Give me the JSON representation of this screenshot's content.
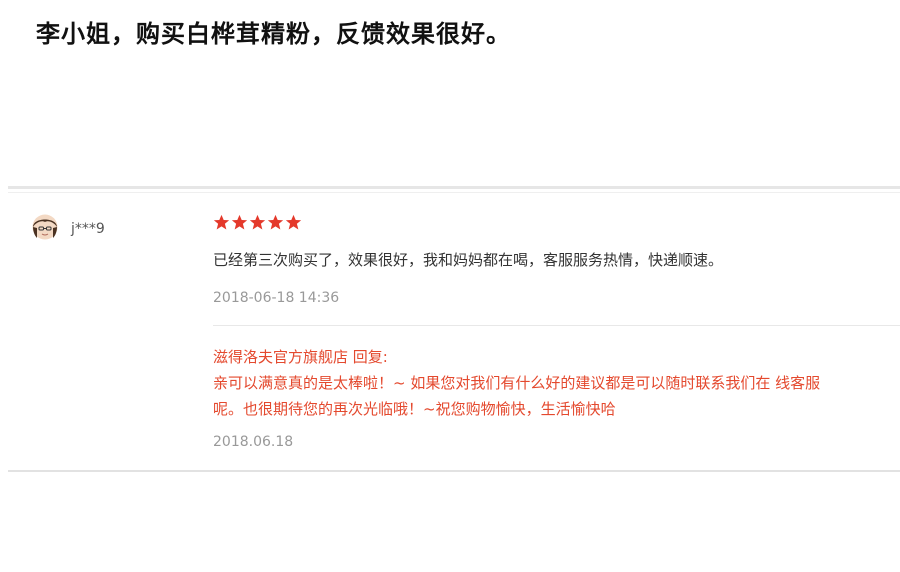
{
  "headline": "李小姐，购买白桦茸精粉，反馈效果很好。",
  "review": {
    "user": "j***9",
    "avatar_icon": "user-avatar-icon",
    "rating": 5,
    "rating_max": 5,
    "star_color": "#e4392b",
    "comment": "已经第三次购买了，效果很好，我和妈妈都在喝，客服服务热情，快递顺速。",
    "date": "2018-06-18 14:36",
    "seller_reply": {
      "header": "滋得洛夫官方旗舰店 回复:",
      "line1": "亲可以满意真的是太棒啦！~ 如果您对我们有什么好的建议都是可以随时联系我们在 线客服",
      "line2": "呢。也很期待您的再次光临哦！~祝您购物愉快，生活愉快哈",
      "date": "2018.06.18",
      "color": "#e4492e"
    }
  }
}
